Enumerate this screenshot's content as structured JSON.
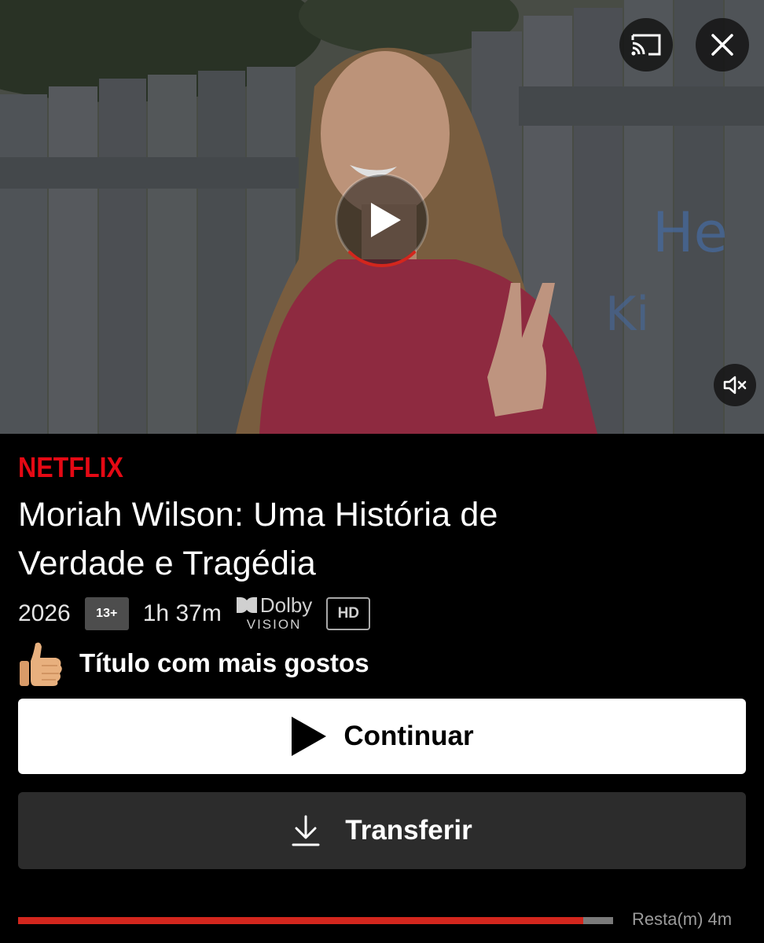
{
  "brand": {
    "name": "NETFLIX"
  },
  "title": {
    "line1": "Moriah Wilson: Uma História de",
    "line2": "Verdade e Tragédia"
  },
  "meta": {
    "year": "2026",
    "rating": "13+",
    "duration": "1h 37m",
    "dolby_top": "Dolby",
    "dolby_bottom": "VISION",
    "quality": "HD"
  },
  "top_badge": {
    "label": "Título com mais gostos"
  },
  "buttons": {
    "continue_label": "Continuar",
    "download_label": "Transferir"
  },
  "progress": {
    "watched_fraction": 0.95,
    "remaining_label": "Resta(m) 4m"
  },
  "preview": {
    "play_progress_fraction": 0.25
  },
  "icons": [
    "cast-icon",
    "close-icon",
    "play-icon",
    "mute-icon",
    "thumbs-up-icon",
    "download-icon"
  ],
  "colors": {
    "accent": "#d3261d",
    "background": "#000000",
    "secondary_button": "#2c2c2c"
  }
}
